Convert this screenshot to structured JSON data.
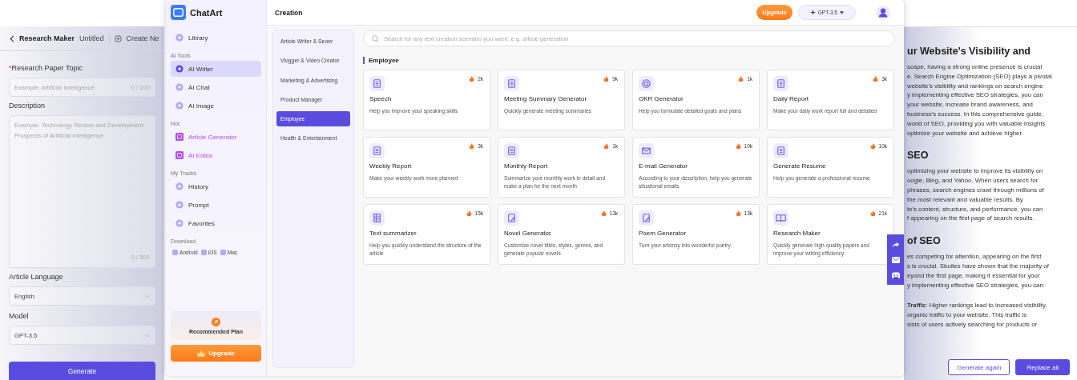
{
  "editor": {
    "back_title": "Research Maker",
    "doc_title": "Untitled",
    "create_label": "Create Ne",
    "fields": [
      {
        "kind": "input",
        "label": "Research Paper Topic",
        "marker": "*",
        "placeholder": "Example: artificial intelligence",
        "counter": "0 / 100"
      },
      {
        "kind": "textarea",
        "label": "Description",
        "placeholder": "Example: Technology Review and Development Prospects of Artificial Intelligence",
        "counter": "0 / 500"
      },
      {
        "kind": "select",
        "label": "Article Language",
        "value": "English"
      },
      {
        "kind": "select",
        "label": "Model",
        "value": "GPT-3.5"
      }
    ],
    "generate": "Generate"
  },
  "article": {
    "blocks": [
      {
        "kind": "heading",
        "lines": [
          "ur Website's Visibility and"
        ]
      },
      {
        "kind": "paragraph",
        "lines": [
          "scape, having a strong online presence is crucial",
          "e. Search Engine Optimization (SEO) plays a pivotal",
          "website's visibility and rankings on search engine",
          "y implementing effective SEO strategies, you can",
          "your website, increase brand awareness, and",
          "business's success. In this comprehensive guide,",
          "world of SEO, providing you with valuable insights",
          "optimize your website and achieve higher"
        ]
      },
      {
        "kind": "heading",
        "lines": [
          "SEO"
        ]
      },
      {
        "kind": "paragraph",
        "lines": [
          "optimizing your website to improve its visibility on",
          "oogle, Bing, and Yahoo. When users search for",
          "phrases, search engines crawl through millions of",
          "the most relevant and valuable results. By",
          "te's content, structure, and performance, you can",
          "f appearing on the first page of search results."
        ]
      },
      {
        "kind": "heading",
        "lines": [
          "of SEO"
        ]
      },
      {
        "kind": "paragraph",
        "lines": [
          "es competing for attention, appearing on the first",
          "s is crucial. Studies have shown that the majority of",
          "eyond the first page, making it essential for your",
          "y implementing effective SEO strategies, you can:"
        ]
      },
      {
        "kind": "paragraph",
        "lines": [
          "**Traffic**: Higher rankings lead to increased visibility,",
          "organic traffic to your website. This traffic is",
          "sists of users actively searching for products or"
        ]
      }
    ],
    "actions": [
      {
        "label": "Generate again",
        "kind": "secondary"
      },
      {
        "label": "Replace all",
        "kind": "primary"
      }
    ]
  },
  "chatart": {
    "brand": "ChatArt",
    "sections": [
      {
        "items": [
          {
            "label": "Library",
            "kind": "normal",
            "selected": false
          }
        ]
      },
      {
        "title": "AI Tools",
        "items": [
          {
            "label": "AI Writer",
            "kind": "normal",
            "selected": true
          },
          {
            "label": "AI Chat",
            "kind": "normal",
            "selected": false
          },
          {
            "label": "AI Image",
            "kind": "normal",
            "selected": false
          }
        ]
      },
      {
        "title": "Hot",
        "items": [
          {
            "label": "Article Generator",
            "kind": "hot",
            "selected": false
          },
          {
            "label": "AI Editor",
            "kind": "hot",
            "selected": false
          }
        ]
      },
      {
        "title": "My Tracks",
        "items": [
          {
            "label": "History",
            "kind": "normal",
            "selected": false
          },
          {
            "label": "Prompt",
            "kind": "normal",
            "selected": false
          },
          {
            "label": "Favorites",
            "kind": "normal",
            "selected": false
          }
        ]
      }
    ],
    "download_title": "Download",
    "downloads": [
      "Android",
      "iOS",
      "Mac"
    ],
    "plan": "Recommended Plan",
    "upgrade": "Upgrade",
    "header": {
      "title": "Creation",
      "upgrade": "Upgrade",
      "model": "GPT-3.5"
    },
    "categories": [
      {
        "label": "Article Writer & Seoer",
        "selected": false
      },
      {
        "label": "Vlogger & Video Creator",
        "selected": false
      },
      {
        "label": "Marketing & Advertising",
        "selected": false
      },
      {
        "label": "Product Manager",
        "selected": false
      },
      {
        "label": "Employee",
        "selected": true
      },
      {
        "label": "Health & Entertainment",
        "selected": false
      }
    ],
    "search": {
      "placeholder": "Search for any text creation scenario you want. e.g. article generation"
    },
    "section_title": "Employee",
    "cards": [
      {
        "title": "Speech",
        "desc": "Help you improve your speaking skills",
        "count": "2k"
      },
      {
        "title": "Meeting Summary Generator",
        "desc": "Quickly generate meeting summaries",
        "count": "9k"
      },
      {
        "title": "OKR Generator",
        "desc": "Help you formulate detailed goals and plans",
        "count": "1k"
      },
      {
        "title": "Daily Report",
        "desc": "Make your daily work report full and detailed",
        "count": "3k"
      },
      {
        "title": "Weekly Report",
        "desc": "Make your weekly work more planned",
        "count": "3k"
      },
      {
        "title": "Monthly Report",
        "desc": "Summarize your monthly work in detail and make a plan for the next month",
        "count": "1k"
      },
      {
        "title": "E-mail Generator",
        "desc": "According to your description, help you generate situational emails",
        "count": "10k"
      },
      {
        "title": "Generate Resume",
        "desc": "Help you generate a professional resume",
        "count": "10k"
      },
      {
        "title": "Text summarizer",
        "desc": "Help you quickly understand the structure of the article",
        "count": "15k"
      },
      {
        "title": "Novel Generator",
        "desc": "Customize novel titles, styles, genres, and generate popular novels",
        "count": "13k"
      },
      {
        "title": "Poem Generator",
        "desc": "Turn your whimsy into wonderful poetry",
        "count": "13k"
      },
      {
        "title": "Research Maker",
        "desc": "Quickly generate high-quality papers and improve your writing efficiency",
        "count": "21k"
      }
    ]
  }
}
